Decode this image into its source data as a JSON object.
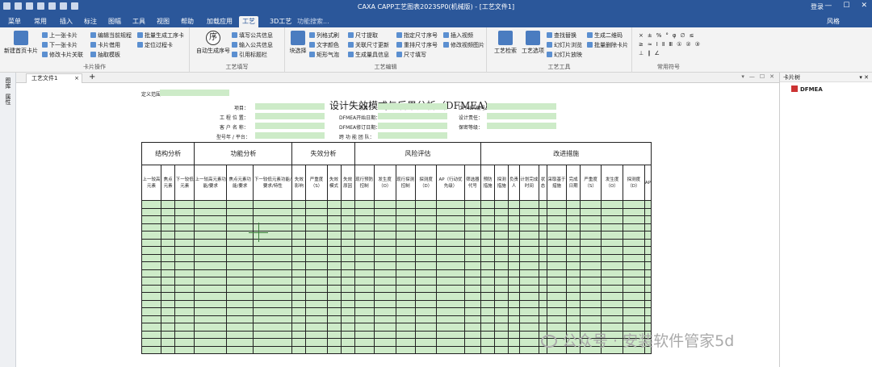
{
  "titlebar": {
    "title": "CAXA CAPP工艺图表2023SP0(机械版) - [工艺文件1]",
    "login": "登录",
    "minimize": "—",
    "maximize": "☐",
    "close": "✕"
  },
  "menu": {
    "tabs": [
      "菜单",
      "常用",
      "插入",
      "标注",
      "图幅",
      "工具",
      "视图",
      "帮助",
      "加载应用",
      "工艺",
      "3D工艺"
    ],
    "active": "工艺",
    "search": "功能搜索...",
    "style": "风格"
  },
  "ribbon": {
    "cardops": {
      "label": "卡片操作",
      "new": "新建首页卡片",
      "prev": "上一张卡片",
      "next": "下一张卡片",
      "modlink": "修改卡片关联",
      "edit": "编辑当前规程",
      "ref": "卡片借用",
      "extract": "抽取模板",
      "batch": "批量生成工序卡",
      "locate": "定位过程卡"
    },
    "fill": {
      "label": "工艺填写",
      "auto": "自动生成序号",
      "common": "填写公共信息",
      "input": "输入公共信息",
      "cite": "引用标题栏"
    },
    "edit": {
      "label": "工艺编辑",
      "block": "块选择",
      "list": "列格式刷",
      "text": "文字颜色",
      "rect": "矩形气泡",
      "dim": "尺寸提取",
      "assoc": "关联尺寸更新",
      "gen": "生成量具信息",
      "seq": "指定尺寸序号",
      "clear": "重排尺寸序号",
      "fill": "尺寸填写",
      "insert": "插入视频",
      "modv": "修改视频图片"
    },
    "tools": {
      "label": "工艺工具",
      "check": "工艺检索",
      "opt": "工艺选项",
      "find": "查找替换",
      "slide": "幻灯片浏览",
      "play": "幻灯片放映",
      "qr": "生成二维码",
      "batchdel": "批量删除卡片"
    },
    "sym": {
      "label": "常用符号",
      "glyphs": [
        "×",
        "±",
        "%",
        "°",
        "φ",
        "∅",
        "≤",
        "≥",
        "≈",
        "Ⅰ",
        "Ⅱ",
        "Ⅲ",
        "①",
        "②",
        "③",
        "⊥",
        "∥",
        "∠"
      ]
    }
  },
  "leftstrip": [
    "图库",
    "属性"
  ],
  "doc": {
    "tab": "工艺文件1",
    "close": "×",
    "plus": "+",
    "ctl": [
      "▾",
      "—",
      "☐",
      "✕"
    ]
  },
  "rpanel": {
    "title": "卡片树",
    "ctl": "▾ ✕",
    "node": "DFMEA"
  },
  "form": {
    "title": "设计失效模式与后果分析（DFMEA）",
    "labels": {
      "def": "定义范围",
      "proj": "项目：",
      "proj2": "项目：",
      "num": "DFMEA编号：",
      "factory": "工 程 位 置：",
      "start": "DFMEA开始日期：",
      "resp": "设计责任：",
      "customer": "客 户 名 称：",
      "rev": "DFMEA修订日期：",
      "conf": "保密等级：",
      "model": "型号年 / 平台：",
      "team": "跨 功 能 团 队："
    },
    "h1": [
      "结构分析",
      "功能分析",
      "失效分析",
      "风险评估",
      "改进措施"
    ],
    "h2": [
      "上一较高元素",
      "焦点元素",
      "下一较低元素",
      "上一较高元素功能/要求",
      "焦点元素功能/要求",
      "下一较低元素功能/要求/特性",
      "失效影响",
      "严重度（S）",
      "失效模式",
      "失效原因",
      "现行预防控制",
      "发生度（O）",
      "现行探测控制",
      "探测度（D）",
      "AP（行动优先级）",
      "筛选器代号",
      "预防措施",
      "探测措施",
      "负责人",
      "计划完成时间",
      "状态",
      "采取基于措施",
      "完成日期",
      "严重度（S）",
      "发生度（O）",
      "探测度（D）",
      "AP"
    ]
  },
  "watermark": "公众号 · 安装软件管家5d"
}
